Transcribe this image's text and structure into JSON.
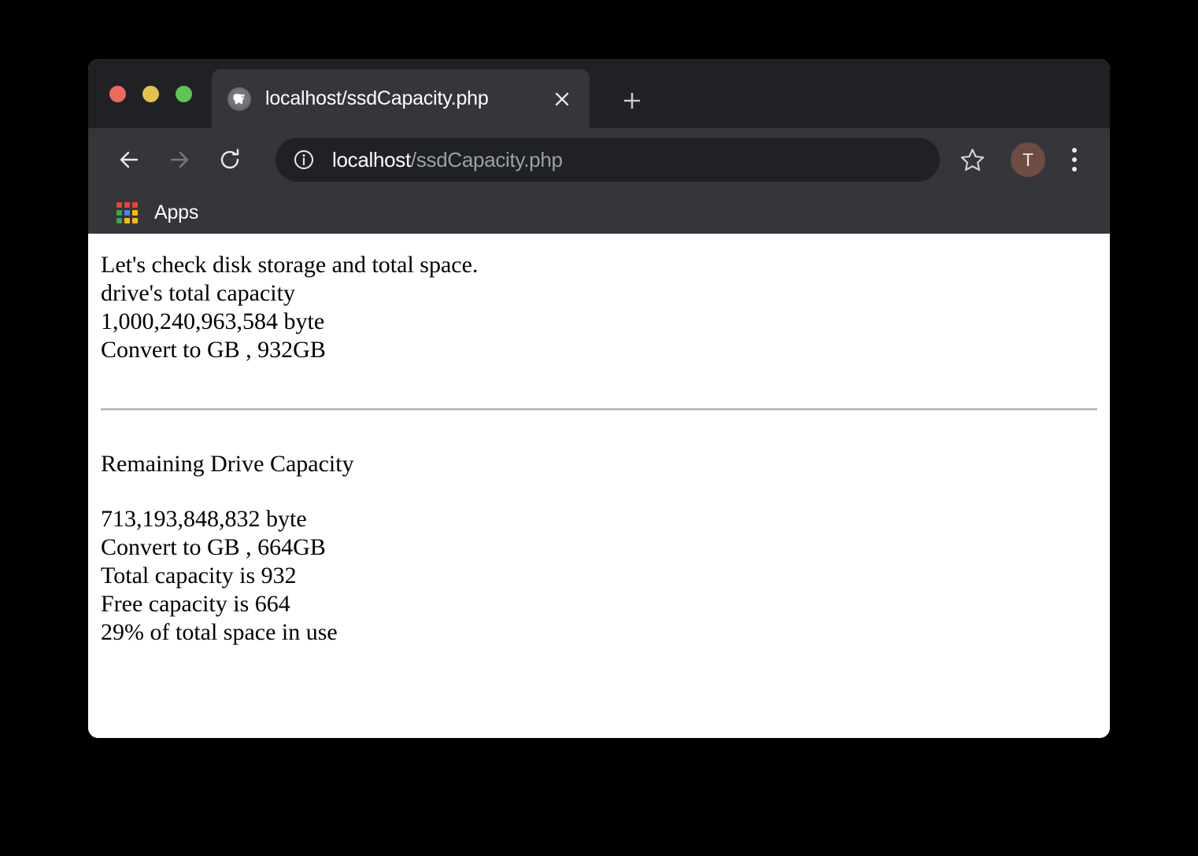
{
  "window": {
    "traffic_lights": [
      {
        "name": "close",
        "color": "#EC6A5E"
      },
      {
        "name": "minimize",
        "color": "#E3C24C"
      },
      {
        "name": "zoom",
        "color": "#61C454"
      }
    ]
  },
  "tab_strip": {
    "active_tab": {
      "title": "localhost/ssdCapacity.php",
      "favicon": "php-elephant-icon",
      "close_icon": "close-icon"
    },
    "new_tab_icon": "plus-icon"
  },
  "toolbar": {
    "back_icon": "arrow-left-icon",
    "forward_icon": "arrow-right-icon",
    "reload_icon": "reload-icon",
    "site_info_icon": "info-circle-icon",
    "url_host": "localhost",
    "url_path": "/ssdCapacity.php",
    "bookmark_icon": "star-icon",
    "profile_initial": "T",
    "menu_icon": "three-dot-menu-icon"
  },
  "bookmarks_bar": {
    "apps_label": "Apps",
    "apps_icon": "apps-grid-icon",
    "apps_grid_colors": [
      "#EA4335",
      "#EA4335",
      "#EA4335",
      "#34A853",
      "#4285F4",
      "#FBBC05",
      "#34A853",
      "#FBBC05",
      "#FBBC05"
    ]
  },
  "page": {
    "section_one": {
      "line_1": "Let's check disk storage and total space.",
      "line_2": "drive's total capacity",
      "line_3": "1,000,240,963,584 byte",
      "line_4": "Convert to GB , 932GB"
    },
    "divider": "horizontal-rule",
    "section_two": {
      "heading": "Remaining Drive Capacity",
      "line_1": "713,193,848,832 byte",
      "line_2": "Convert to GB , 664GB",
      "line_3": "Total capacity is 932",
      "line_4": "Free capacity is 664",
      "line_5": "29% of total space in use"
    }
  }
}
